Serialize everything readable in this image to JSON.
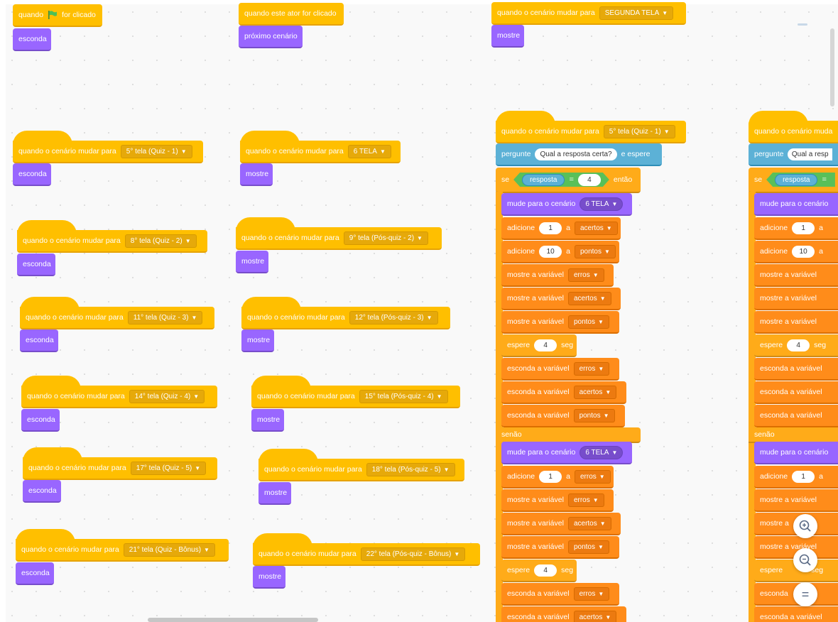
{
  "events": {
    "when_prefix": "quando",
    "when_suffix": "for clicado",
    "when_sprite_clicked": "quando este ator for clicado",
    "when_backdrop": "quando o cenário mudar para"
  },
  "looks": {
    "hide": "esconda",
    "show": "mostre",
    "next_backdrop": "próximo cenário",
    "switch_backdrop": "mude para o cenário"
  },
  "sensing": {
    "ask": "pergunte",
    "and_wait": "e espere",
    "answer": "resposta",
    "question": "Qual a resposta certa?"
  },
  "control": {
    "if": "se",
    "then": "então",
    "else": "senão",
    "wait": "espere",
    "sec": "seg"
  },
  "variables": {
    "add": "adicione",
    "to": "a",
    "show_var": "mostre a variável",
    "hide_var": "esconda a variável",
    "acertos": "acertos",
    "pontos": "pontos",
    "erros": "erros"
  },
  "backdrops": {
    "segunda": "SEGUNDA TELA",
    "t5": "5° tela (Quiz - 1)",
    "t6": "6 TELA",
    "t8": "8° tela (Quiz - 2)",
    "t9": "9° tela (Pós-quiz - 2)",
    "t11": "11° tela (Quiz - 3)",
    "t12": "12° tela (Pós-quiz - 3)",
    "t14": "14° tela (Quiz - 4)",
    "t15": "15° tela (Pós-quiz - 4)",
    "t17": "17° tela (Quiz - 5)",
    "t18": "18° tela (Pós-quiz - 5)",
    "t21": "21° tela (Quiz - Bônus)",
    "t22": "22° tela (Pós-quiz - Bônus)"
  },
  "numbers": {
    "one": "1",
    "four": "4",
    "ten": "10",
    "eq": "="
  },
  "partial": {
    "when_backdrop_cut": "quando o cenário muda",
    "question_cut": "Qual a resp",
    "switch_cut": "mude para o cenário",
    "add_cut": "adicione",
    "show_var_cut": "mostre a variável",
    "hide_var_cut": "esconda a variável",
    "show_a_cut": "mostre a",
    "show_cut2": "mostre a variável",
    "hide_cut2": "esconda",
    "sec_cut": "seg"
  },
  "zoom": {
    "in": "+",
    "out": "−",
    "reset": "="
  },
  "colors": {
    "events": "#ffbf00",
    "looks": "#9966ff",
    "sensing": "#5cb1d6",
    "control": "#ffab19",
    "variables": "#ff8c1a",
    "operators": "#59c059"
  }
}
